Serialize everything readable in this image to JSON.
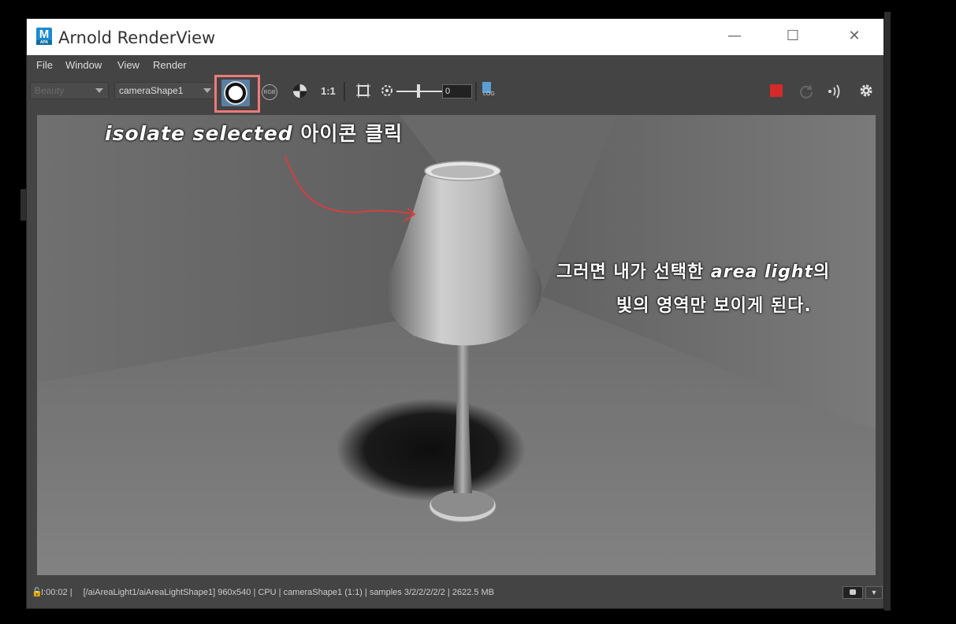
{
  "window": {
    "title": "Arnold RenderView",
    "app_icon": "M",
    "app_icon_sub": "APA",
    "minimize_icon": "—",
    "maximize_icon": "☐",
    "close_icon": "✕"
  },
  "menu": {
    "items": [
      {
        "label": "File"
      },
      {
        "label": "Window"
      },
      {
        "label": "View"
      },
      {
        "label": "Render"
      }
    ]
  },
  "toolbar": {
    "aov_dropdown": "Beauty",
    "camera_dropdown": "cameraShape1",
    "rgb_label": "RGB",
    "ratio_label": "1:1",
    "exposure_value": "0",
    "log_label": "LOG",
    "highlight_color": "#f07a7a",
    "stop_color": "#d42a2a"
  },
  "statusbar": {
    "time": "I:00:02 |",
    "path": "[/aiAreaLight1/aiAreaLightShape1]",
    "info": " 960x540 | CPU | cameraShape1 (1:1) | samples 3/2/2/2/2/2 | 2622.5 MB"
  },
  "annotations": {
    "isolate_en": "isolate selected",
    "isolate_ko": " 아이콘 클릭",
    "line1_ko": "그러면 내가 선택한 ",
    "line1_en": "area light",
    "line1_end": "의",
    "line2": "빛의 영역만 보이게 된다."
  }
}
